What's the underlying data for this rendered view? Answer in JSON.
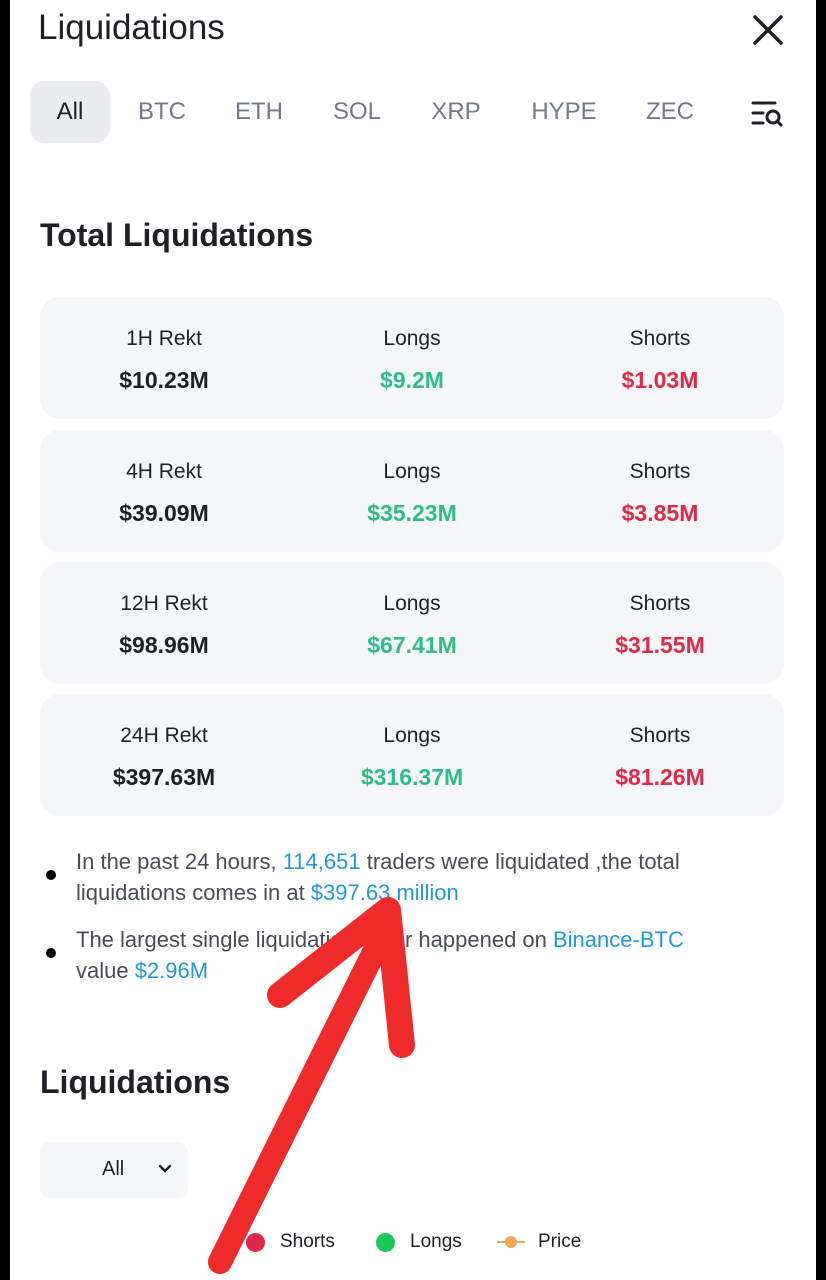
{
  "header": {
    "title": "Liquidations"
  },
  "tabs": [
    "All",
    "BTC",
    "ETH",
    "SOL",
    "XRP",
    "HYPE",
    "ZEC"
  ],
  "total": {
    "title": "Total Liquidations",
    "rows": [
      {
        "label": "1H Rekt",
        "value": "$10.23M",
        "longs_label": "Longs",
        "longs": "$9.2M",
        "shorts_label": "Shorts",
        "shorts": "$1.03M"
      },
      {
        "label": "4H Rekt",
        "value": "$39.09M",
        "longs_label": "Longs",
        "longs": "$35.23M",
        "shorts_label": "Shorts",
        "shorts": "$3.85M"
      },
      {
        "label": "12H Rekt",
        "value": "$98.96M",
        "longs_label": "Longs",
        "longs": "$67.41M",
        "shorts_label": "Shorts",
        "shorts": "$31.55M"
      },
      {
        "label": "24H Rekt",
        "value": "$397.63M",
        "longs_label": "Longs",
        "longs": "$316.37M",
        "shorts_label": "Shorts",
        "shorts": "$81.26M"
      }
    ]
  },
  "notes": {
    "b1_a": "In the past 24 hours, ",
    "b1_traders": "114,651",
    "b1_b": " traders were liquidated ,the total liquidations comes in at ",
    "b1_total": "$397.63 million",
    "b2_a": "The largest single liquidation order happened on ",
    "b2_exchange": "Binance-BTC",
    "b2_b": " value ",
    "b2_value": "$2.96M"
  },
  "chart_section": {
    "title": "Liquidations",
    "dropdown_value": "All",
    "legend": {
      "shorts": "Shorts",
      "longs": "Longs",
      "price": "Price"
    }
  },
  "colors": {
    "longs": "#2ebd85",
    "shorts": "#e0294a",
    "price": "#f0a55c",
    "link": "#1f9ad6",
    "arrow": "#ee2a2a"
  }
}
